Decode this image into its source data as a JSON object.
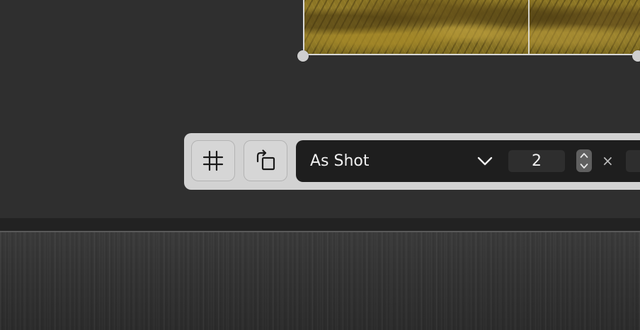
{
  "toolbar": {
    "grid_button": {
      "icon": "grid-icon"
    },
    "rotate_button": {
      "icon": "rotate-icon"
    },
    "aspect": {
      "selected": "As Shot",
      "chevron_icon": "chevron-down-icon",
      "ratio_value": "2",
      "times_symbol": "×"
    }
  },
  "colors": {
    "canvas": "#2f2f2f",
    "toolbar_bg": "#d2d2d2",
    "panel_bg": "#1e1e1e",
    "crop_handle": "#cfcfcf"
  }
}
